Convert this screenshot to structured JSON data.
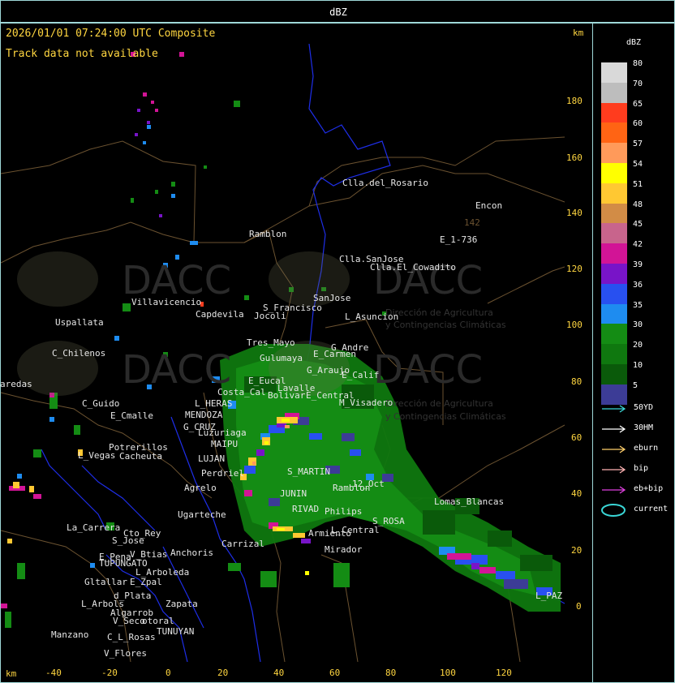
{
  "top_title": "dBZ",
  "header": {
    "timestamp": "2026/01/01 07:24:00 UTC Composite",
    "track_note": "Track data not available",
    "km_right": "km",
    "km_bottom": "km"
  },
  "axes": {
    "x_ticks": [
      "-40",
      "-20",
      "0",
      "20",
      "40",
      "60",
      "80",
      "100",
      "120"
    ],
    "y_ticks": [
      "180",
      "160",
      "140",
      "120",
      "100",
      "80",
      "60",
      "40",
      "20",
      "0"
    ]
  },
  "places": {
    "clla_rosario": "Clla.del_Rosario",
    "encon": "Encon",
    "n142": "142",
    "e1736": "E_1-736",
    "ramblon": "Ramblon",
    "clla_sanjose": "Clla.SanJose",
    "clla_elcowadito": "Clla.El_Cowadito",
    "villavicencio": "Villavicencio",
    "sfrancisco": "S_Francisco",
    "sanjose": "SanJose",
    "capdevila": "Capdevila",
    "jocoli": "Jocoli",
    "lasuncion": "L_Asuncion",
    "uspallata": "Uspallata",
    "tresmayo": "Tres_Mayo",
    "cchilenos": "C_Chilenos",
    "gandre": "G_Andre",
    "ecarmen": "E_Carmen",
    "gulumaya": "Gulumaya",
    "garaujo": "G_Araujo",
    "ecalif": "E_Calif",
    "aredas": "aredas",
    "eeucal": "E_Eucal",
    "lavalle": "Lavalle",
    "costacal": "Costa_Cal",
    "bolivar": "Bolivar",
    "ecentral": "E_Central",
    "mvisadero": "M_Visadero",
    "cguido": "C_Guido",
    "lhera": "L_HERAS",
    "mendoza": "MENDOZA",
    "ecmalle": "E_Cmalle",
    "gcruz": "G_CRUZ",
    "luzuriaga": "Luzuriaga",
    "potrerillos": "Potrerillos",
    "maipu": "MAIPU",
    "lvegas": "L_Vegas",
    "cacheuta": "Cacheuta",
    "lujan": "LUJAN",
    "smartin": "S_MARTIN",
    "perdriel": "Perdriel",
    "ramblon2": "Ramblon",
    "agrelo": "Agrelo",
    "junin": "JUNIN",
    "n12oct": "12_Oct",
    "lomasblancas": "Lomas_Blancas",
    "ugarteche": "Ugarteche",
    "rivad": "RIVAD",
    "phillips": "Philips",
    "srosa": "S_ROSA",
    "lacarrera": "La_Carrera",
    "ctorey": "Cto_Rey",
    "sjose": "S_Jose",
    "carrizal": "Carrizal",
    "armiento": "Armiento",
    "lcentral": "L_Central",
    "epena": "E_Pena",
    "vbtias": "V_Btias",
    "anchoris": "Anchoris",
    "tupungato": "TUPUNGATO",
    "mirador": "Mirador",
    "larboleda": "L_Arboleda",
    "gltallar": "Gltallar",
    "ezpal": "E_Zpal",
    "dplata": "d_Plata",
    "larbols": "L_Arbols",
    "algarrob": "Algarrob",
    "zapata": "Zapata",
    "vseco": "V_Seco",
    "otoral": "otoral",
    "tunuyan": "TUNUYAN",
    "manzano": "Manzano",
    "clrosas": "C_L_Rosas",
    "vflores": "V_Flores",
    "lpaz": "L_PAZ"
  },
  "watermark": {
    "brand": "DACC",
    "line1": "Dirección de Agricultura",
    "line2": "y Contingencias Climáticas"
  },
  "legend": {
    "title": "dBZ",
    "levels": [
      {
        "value": "80",
        "color": "#d9d9d9"
      },
      {
        "value": "70",
        "color": "#bdbdbd"
      },
      {
        "value": "65",
        "color": "#ff3c1e"
      },
      {
        "value": "60",
        "color": "#ff6414"
      },
      {
        "value": "57",
        "color": "#ff9a5a"
      },
      {
        "value": "54",
        "color": "#ffff00"
      },
      {
        "value": "51",
        "color": "#ffc832"
      },
      {
        "value": "48",
        "color": "#d28c46"
      },
      {
        "value": "45",
        "color": "#c8648c"
      },
      {
        "value": "42",
        "color": "#d21496"
      },
      {
        "value": "39",
        "color": "#7814c8"
      },
      {
        "value": "36",
        "color": "#2850f0"
      },
      {
        "value": "35",
        "color": "#1e8cf0"
      },
      {
        "value": "30",
        "color": "#148c14"
      },
      {
        "value": "20",
        "color": "#0f780f"
      },
      {
        "value": "10",
        "color": "#0a5a0a"
      },
      {
        "value": "5",
        "color": "#3c3c96"
      }
    ],
    "tracks": [
      {
        "label": "50YD",
        "color": "#3ad6d6"
      },
      {
        "label": "30HM",
        "color": "#ffffff"
      },
      {
        "label": "eburn",
        "color": "#ffcf6a"
      },
      {
        "label": "bip",
        "color": "#ffb3b3"
      },
      {
        "label": "eb+bip",
        "color": "#e040e0"
      },
      {
        "label": "current",
        "color": "#3ad6d6"
      }
    ]
  }
}
